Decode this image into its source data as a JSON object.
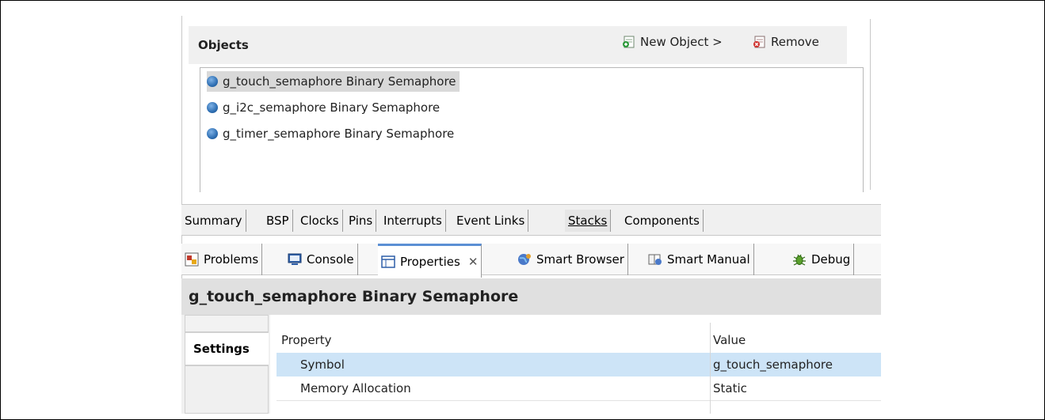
{
  "objects": {
    "title": "Objects",
    "new_object_label": "New Object >",
    "remove_label": "Remove",
    "items": [
      {
        "label": "g_touch_semaphore Binary Semaphore"
      },
      {
        "label": "g_i2c_semaphore Binary Semaphore"
      },
      {
        "label": "g_timer_semaphore Binary Semaphore"
      }
    ]
  },
  "editor_tabs": [
    "Summary",
    "BSP",
    "Clocks",
    "Pins",
    "Interrupts",
    "Event Links",
    "Stacks",
    "Components"
  ],
  "editor_active": "Stacks",
  "view_tabs": [
    {
      "label": "Problems",
      "icon": "problems-icon"
    },
    {
      "label": "Console",
      "icon": "console-icon"
    },
    {
      "label": "Properties",
      "icon": "properties-icon"
    },
    {
      "label": "Smart Browser",
      "icon": "smart-browser-icon"
    },
    {
      "label": "Smart Manual",
      "icon": "smart-manual-icon"
    },
    {
      "label": "Debug",
      "icon": "debug-icon"
    }
  ],
  "properties": {
    "title": "g_touch_semaphore Binary Semaphore",
    "settings_tab": "Settings",
    "col_property": "Property",
    "col_value": "Value",
    "rows": [
      {
        "property": "Symbol",
        "value": "g_touch_semaphore"
      },
      {
        "property": "Memory Allocation",
        "value": "Static"
      }
    ]
  },
  "colors": {
    "selection_blue": "#cde4f7",
    "panel_gray": "#f0f0f0",
    "accent": "#5b8fd4"
  }
}
